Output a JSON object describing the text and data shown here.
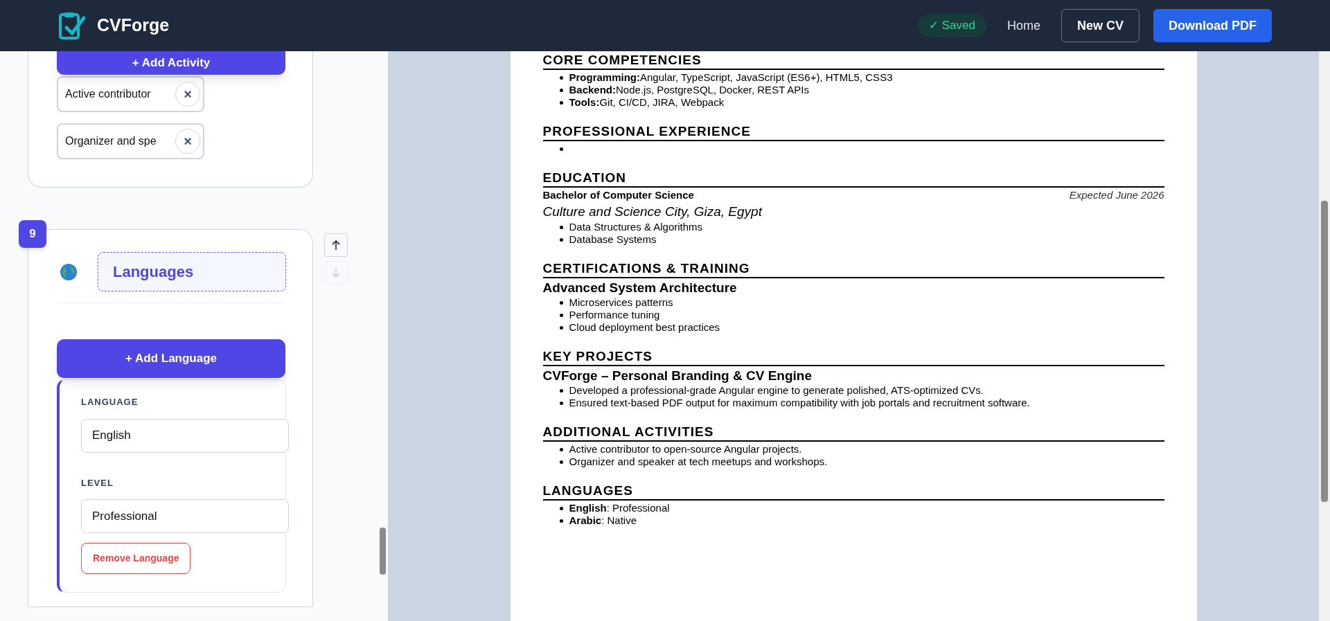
{
  "header": {
    "logo_text": "CVForge",
    "saved_badge": "✓ Saved",
    "nav_link": "Home",
    "new_button": "New CV",
    "download_button": "Download PDF"
  },
  "editor": {
    "activities": {
      "add_button": "+ Add Activity",
      "chips": [
        {
          "text": "Active contributor"
        },
        {
          "text": "Organizer and spe"
        }
      ],
      "remove_glyph": "×"
    },
    "languages_section": {
      "number": "9",
      "title": "Languages",
      "move_up": {
        "disabled": false
      },
      "move_down": {
        "disabled": true
      },
      "add_button": "+ Add Language",
      "entries": [
        {
          "language_label": "LANGUAGE",
          "language": "English",
          "level_label": "LEVEL",
          "level": "Professional",
          "remove_button": "Remove Language"
        }
      ]
    }
  },
  "cv": {
    "sections": [
      {
        "kind": "skills",
        "heading": "CORE COMPETENCIES",
        "items": [
          "**Programming:**Angular, TypeScript, JavaScript (ES6+), HTML5, CSS3",
          "**Backend:**Node.js, PostgreSQL, Docker, REST APIs",
          "**Tools:**Git, CI/CD, JIRA, Webpack"
        ]
      },
      {
        "kind": "empty",
        "heading": "PROFESSIONAL EXPERIENCE"
      },
      {
        "kind": "education",
        "heading": "EDUCATION",
        "degree": "Bachelor of Computer Science",
        "date": "Expected June 2026",
        "school": "Culture and Science City, Giza, Egypt",
        "items": [
          "Data Structures & Algorithms",
          "Database Systems"
        ]
      },
      {
        "kind": "entry",
        "heading": "CERTIFICATIONS & TRAINING",
        "title": "Advanced System Architecture",
        "items": [
          "Microservices patterns",
          "Performance tuning",
          "Cloud deployment best practices"
        ]
      },
      {
        "kind": "entry",
        "heading": "KEY PROJECTS",
        "title": "CVForge – Personal Branding & CV Engine",
        "items": [
          "Developed a professional-grade Angular engine to generate polished, ATS-optimized CVs.",
          "Ensured text-based PDF output for maximum compatibility with job portals and recruitment software."
        ]
      },
      {
        "kind": "bullets",
        "heading": "ADDITIONAL ACTIVITIES",
        "items": [
          "Active contributor to open-source Angular projects.",
          "Organizer and speaker at tech meetups and workshops."
        ]
      },
      {
        "kind": "skills",
        "heading": "LANGUAGES",
        "items": [
          "**English**: Professional",
          "**Arabic**: Native"
        ]
      }
    ]
  }
}
